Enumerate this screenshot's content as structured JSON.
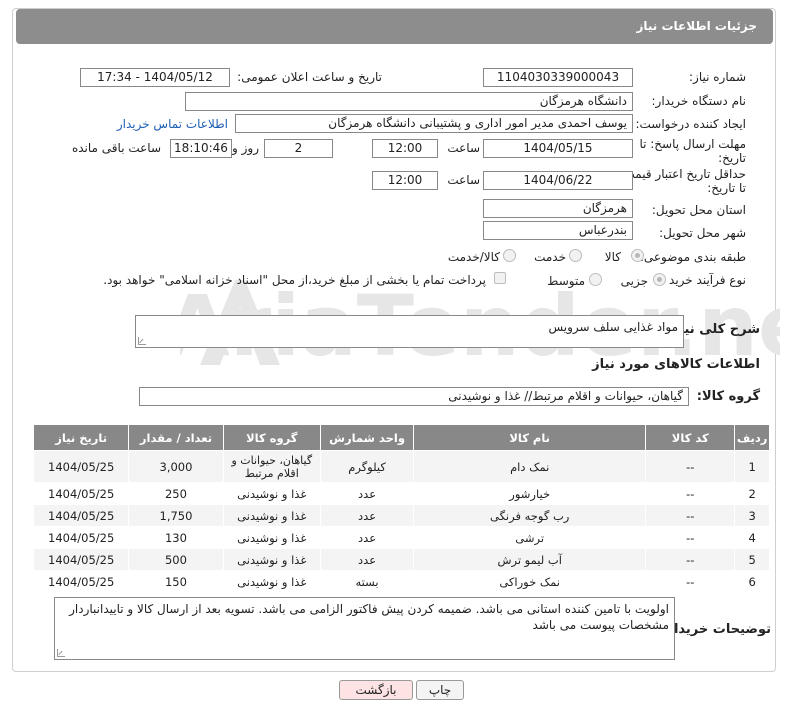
{
  "header": {
    "title": "جزئیات اطلاعات نیاز"
  },
  "fields": {
    "need_number_label": "شماره نیاز:",
    "need_number": "1104030339000043",
    "announce_label": "تاریخ و ساعت اعلان عمومی:",
    "announce_value": "1404/05/12 - 17:34",
    "buyer_org_label": "نام دستگاه خریدار:",
    "buyer_org": "دانشگاه هرمزگان",
    "requester_label": "ایجاد کننده درخواست:",
    "requester": "یوسف احمدی مدیر امور اداری و پشتیبانی دانشگاه هرمزگان",
    "buyer_contact_link": "اطلاعات تماس خریدار",
    "deadline_label_1": "مهلت ارسال پاسخ: تا",
    "deadline_label_2": "تاریخ:",
    "deadline_date": "1404/05/15",
    "time_label": "ساعت",
    "deadline_time": "12:00",
    "days_value": "2",
    "days_label": "روز و",
    "remaining_time": "18:10:46",
    "remaining_label": "ساعت باقی مانده",
    "validity_label_1": "حداقل تاریخ اعتبار قیمت:",
    "validity_label_2": "تا تاریخ:",
    "validity_date": "1404/06/22",
    "validity_time": "12:00",
    "province_label": "استان محل تحویل:",
    "province": "هرمزگان",
    "city_label": "شهر محل تحویل:",
    "city": "بندرعباس",
    "category_label": "طبقه بندی موضوعی:",
    "category_options": [
      "کالا",
      "خدمت",
      "کالا/خدمت"
    ],
    "category_selected": "کالا",
    "process_label": "نوع فرآیند خرید :",
    "process_options": [
      "جزیی",
      "متوسط"
    ],
    "process_selected": "جزیی",
    "payment_note": "پرداخت تمام یا بخشی از مبلغ خرید،از محل \"اسناد خزانه اسلامی\" خواهد بود."
  },
  "description": {
    "label": "شرح کلی نیاز:",
    "value": "مواد غذایی سلف سرویس"
  },
  "goods_section": {
    "title": "اطلاعات کالاهای مورد نیاز",
    "group_label": "گروه کالا:",
    "group_value": "گیاهان، حیوانات و اقلام مرتبط// غذا و نوشیدنی"
  },
  "table": {
    "headers": [
      "ردیف",
      "کد کالا",
      "نام کالا",
      "واحد شمارش",
      "گروه کالا",
      "تعداد / مقدار",
      "تاریخ نیاز"
    ],
    "rows": [
      [
        "1",
        "--",
        "نمک دام",
        "کیلوگرم",
        "گیاهان، حیوانات و اقلام مرتبط",
        "3,000",
        "1404/05/25"
      ],
      [
        "2",
        "--",
        "خیارشور",
        "عدد",
        "غذا و نوشیدنی",
        "250",
        "1404/05/25"
      ],
      [
        "3",
        "--",
        "رب گوجه فرنگی",
        "عدد",
        "غذا و نوشیدنی",
        "1,750",
        "1404/05/25"
      ],
      [
        "4",
        "--",
        "ترشی",
        "عدد",
        "غذا و نوشیدنی",
        "130",
        "1404/05/25"
      ],
      [
        "5",
        "--",
        "آب لیمو ترش",
        "عدد",
        "غذا و نوشیدنی",
        "500",
        "1404/05/25"
      ],
      [
        "6",
        "--",
        "نمک خوراکی",
        "بسته",
        "غذا و نوشیدنی",
        "150",
        "1404/05/25"
      ]
    ]
  },
  "buyer_notes": {
    "label": "توضیحات خریدار:",
    "value": "اولویت با تامین کننده استانی می باشد. ضمیمه کردن پیش فاکتور الزامی می باشد. تسویه بعد از ارسال کالا و تاییدانباردار مشخصات پیوست می باشد"
  },
  "buttons": {
    "print": "چاپ",
    "back": "بازگشت"
  },
  "colors": {
    "header_bg": "#8d8d8d",
    "link": "#1e5fb4",
    "back_button_bg": "#fde3e3",
    "watermark": "#e4e4e4"
  },
  "watermark": {
    "text": "AriaTender.net"
  }
}
